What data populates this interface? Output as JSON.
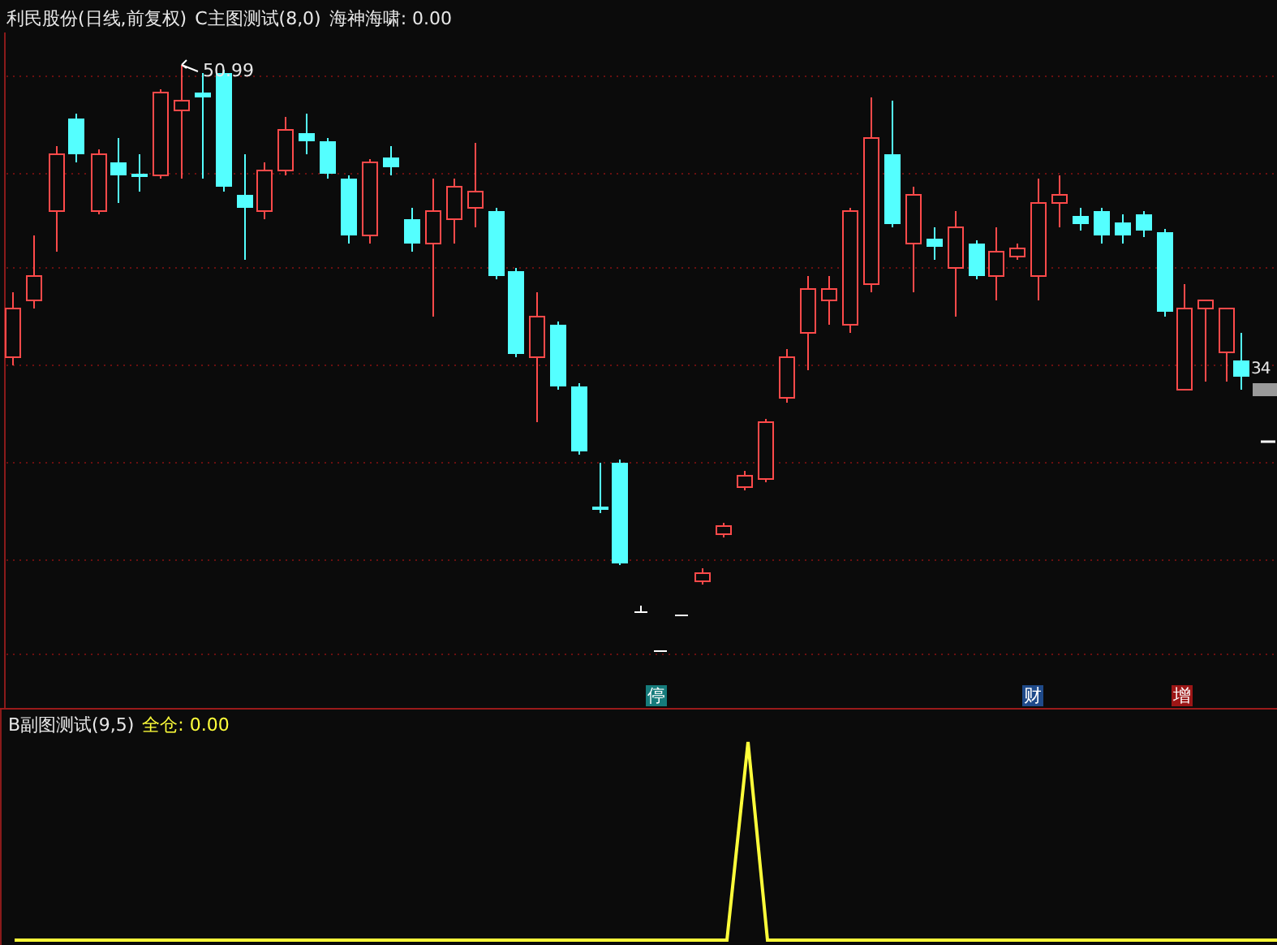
{
  "main_chart": {
    "stock_title": "利民股份(日线,前复权)",
    "indicator": "C主图测试(8,0)",
    "indicator_value": "海神海啸: 0.00",
    "high_label": "50.99",
    "price_label": "34",
    "signals": [
      {
        "text": "停",
        "color": "#167c7c"
      },
      {
        "text": "财",
        "color": "#1f4a8a"
      },
      {
        "text": "增",
        "color": "#9c1616"
      }
    ]
  },
  "sub_chart": {
    "indicator": "B副图测试(9,5)",
    "value": "全仓: 0.00"
  }
}
